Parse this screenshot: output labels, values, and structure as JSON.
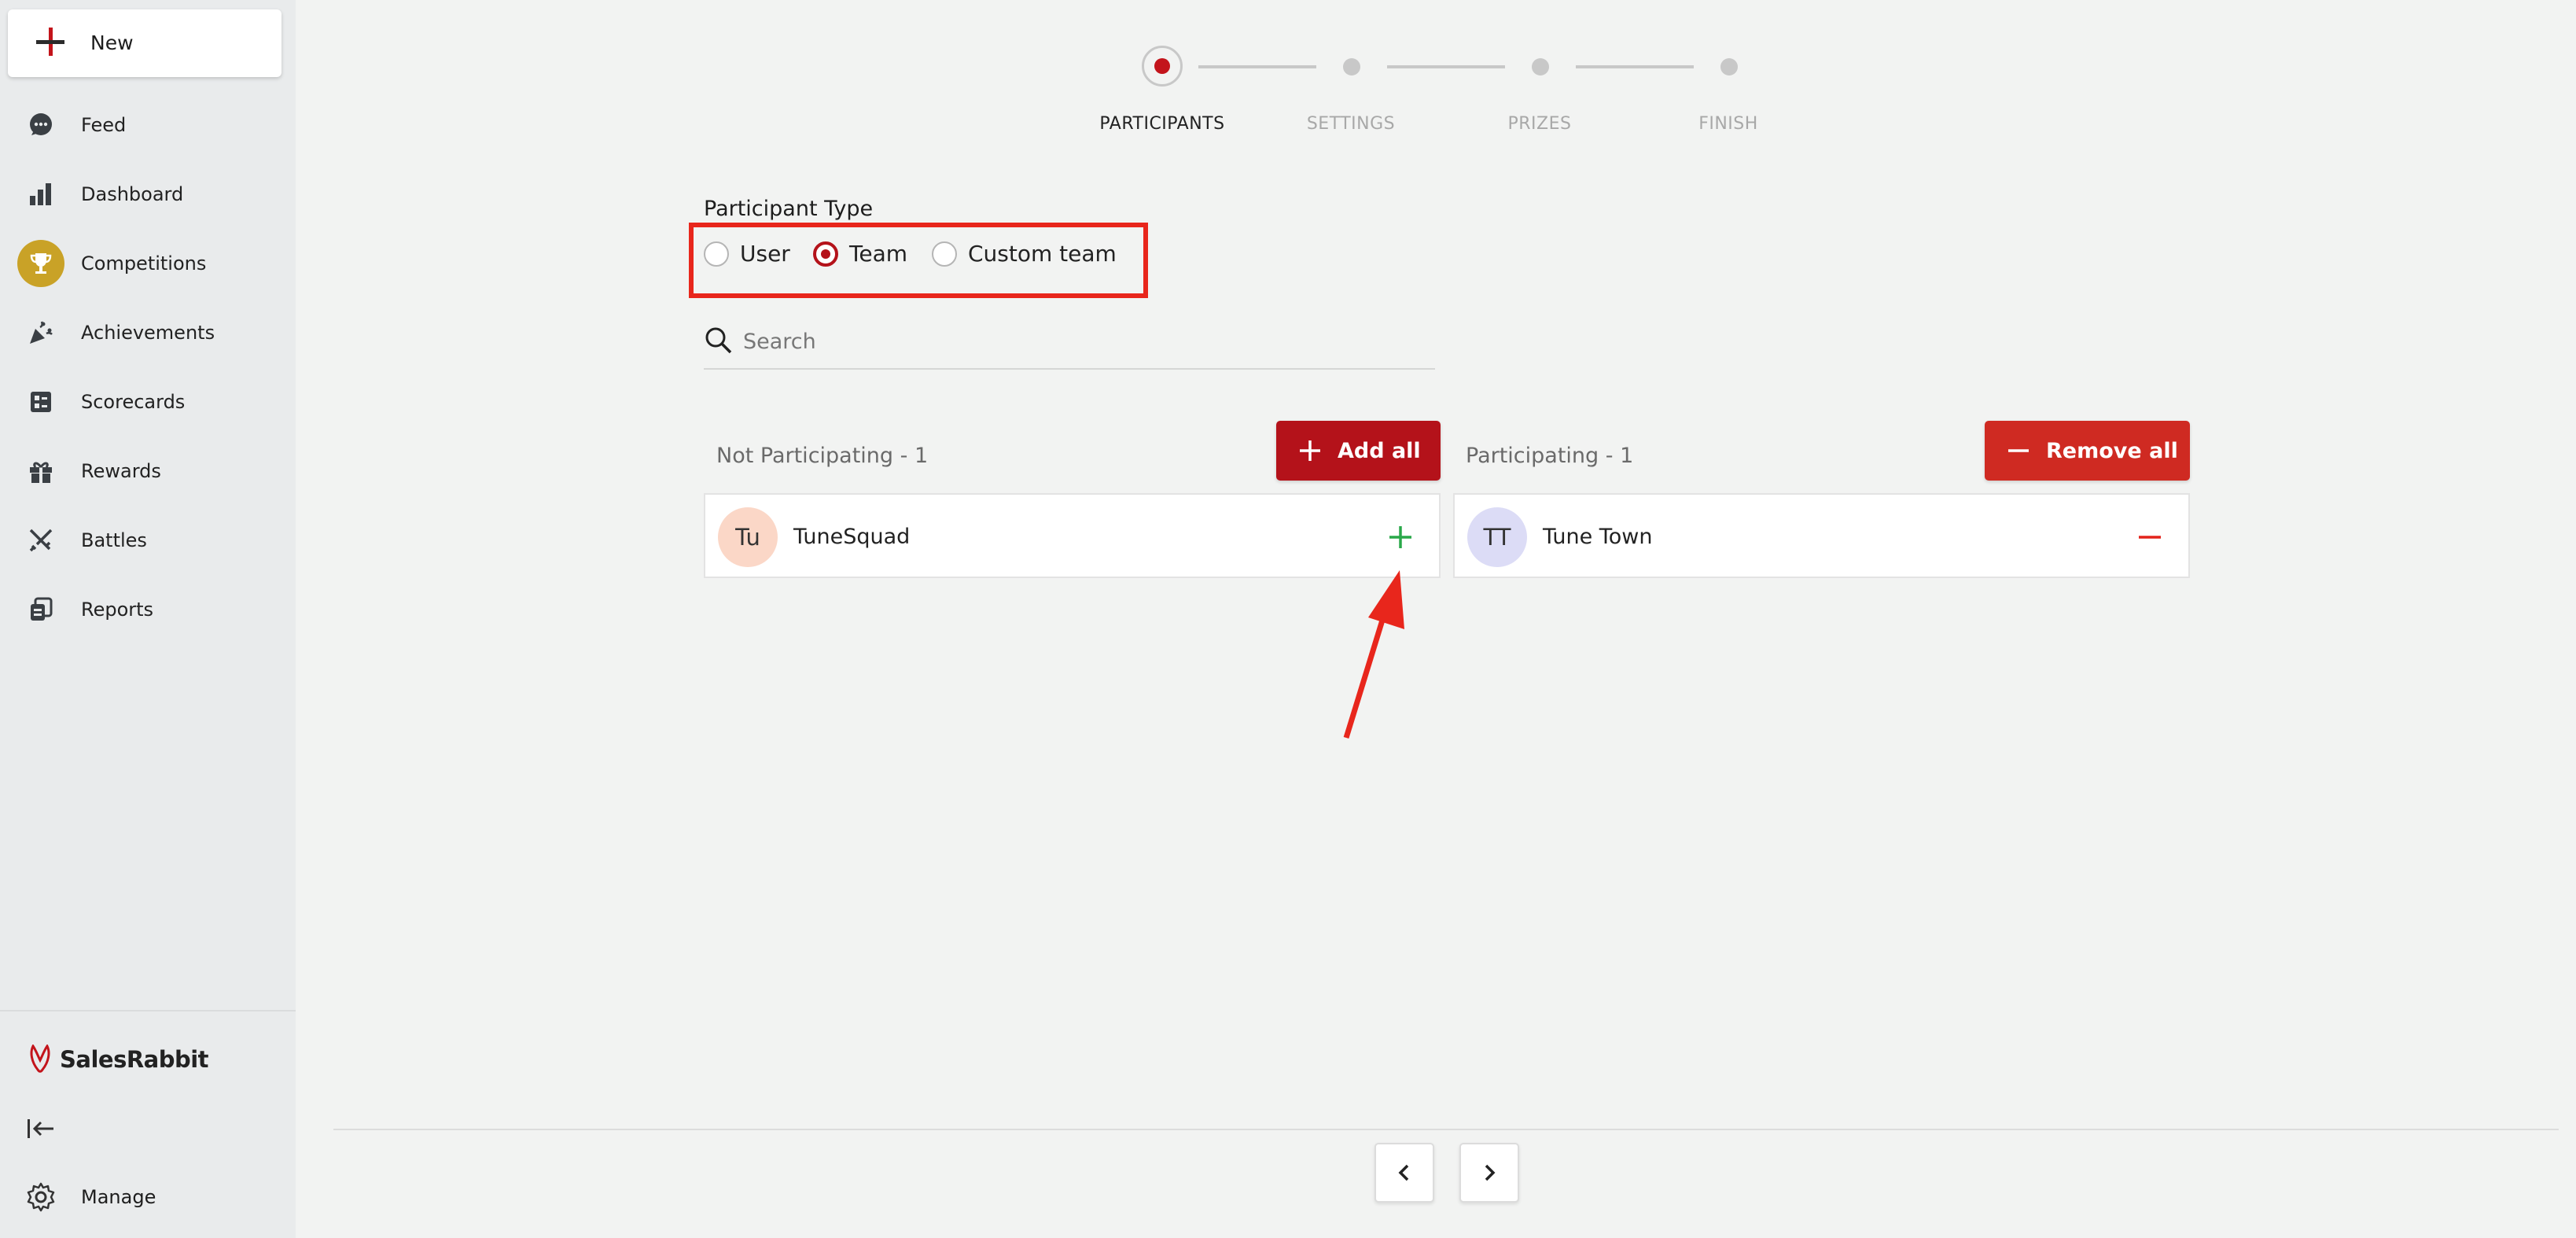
{
  "sidebar": {
    "new_label": "New",
    "items": [
      {
        "label": "Feed",
        "icon": "chat-bubble-icon"
      },
      {
        "label": "Dashboard",
        "icon": "bar-chart-icon"
      },
      {
        "label": "Competitions",
        "icon": "trophy-icon",
        "active": true
      },
      {
        "label": "Achievements",
        "icon": "confetti-icon"
      },
      {
        "label": "Scorecards",
        "icon": "scorecard-icon"
      },
      {
        "label": "Rewards",
        "icon": "gift-icon"
      },
      {
        "label": "Battles",
        "icon": "crossed-swords-icon"
      },
      {
        "label": "Reports",
        "icon": "reports-icon"
      }
    ],
    "brand": "SalesRabbit",
    "manage_label": "Manage"
  },
  "stepper": {
    "steps": [
      {
        "label": "PARTICIPANTS",
        "active": true
      },
      {
        "label": "SETTINGS",
        "active": false
      },
      {
        "label": "PRIZES",
        "active": false
      },
      {
        "label": "FINISH",
        "active": false
      }
    ]
  },
  "participant_type": {
    "label": "Participant Type",
    "options": [
      "User",
      "Team",
      "Custom team"
    ],
    "selected": "Team"
  },
  "search": {
    "placeholder": "Search",
    "value": ""
  },
  "not_participating": {
    "title": "Not Participating - 1",
    "button_label": "Add all",
    "items": [
      {
        "initials": "Tu",
        "name": "TuneSquad",
        "avatar_color": "#fbd7c7"
      }
    ]
  },
  "participating": {
    "title": "Participating - 1",
    "button_label": "Remove all",
    "items": [
      {
        "initials": "TT",
        "name": "Tune Town",
        "avatar_color": "#dcdcf6"
      }
    ]
  },
  "colors": {
    "primary_red": "#b4121a",
    "remove_red": "#cf2a22",
    "add_green": "#2aa84a",
    "highlight": "#e8261c",
    "trophy_gold": "#c9a227"
  }
}
